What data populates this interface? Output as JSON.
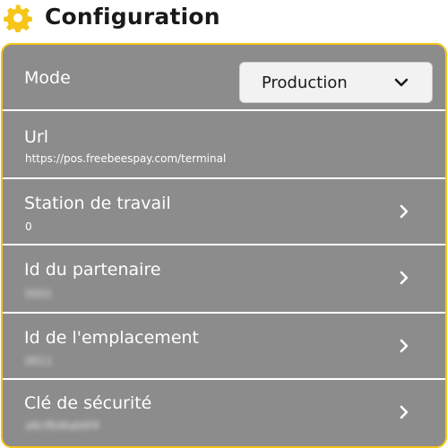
{
  "header": {
    "title": "Configuration",
    "icon": "gear-icon",
    "accent_color": "#f5c518"
  },
  "rows": [
    {
      "label": "Mode",
      "select_value": "Production"
    },
    {
      "label": "Url",
      "value": "https://pos.freebeespay.com/terminal"
    },
    {
      "label": "Station de travail",
      "value": "0"
    },
    {
      "label": "Id du partenaire",
      "value": "0001"
    },
    {
      "label": "Id de l'emplacement",
      "value": "0011"
    },
    {
      "label": "Clé de sécurité",
      "value": "a8cf8d6ab6f4"
    }
  ],
  "colors": {
    "panel_bg": "#8c8c8c",
    "divider": "#ffffff",
    "select_bg": "#f2f2f2"
  }
}
